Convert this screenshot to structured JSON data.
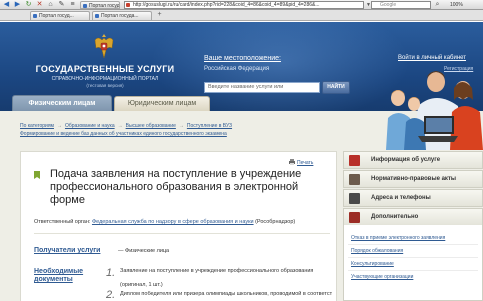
{
  "browser": {
    "tabs": [
      "Портал госуда...",
      "Портал госуд...",
      "Портал госуда..."
    ],
    "url": "http://gosuslugi.ru/ru/card/index.php?rid=228&coid_4=86&coid_4=89&pid_4=286&...",
    "search_placeholder": "Google",
    "zoom": "100%"
  },
  "header": {
    "site_title": "ГОСУДАРСТВЕННЫЕ УСЛУГИ",
    "site_subtitle": "СПРАВОЧНО-ИНФОРМАЦИОННЫЙ ПОРТАЛ",
    "site_version": "(тестовая версия)",
    "location_label": "Ваше местоположение:",
    "location_value": "Российская Федерация",
    "search_placeholder": "Введите название услуги или",
    "find_button": "НАЙТИ",
    "cabinet_link": "Войти в личный кабинет",
    "register_link": "Регистрация"
  },
  "audience_tabs": {
    "individuals": "Физическим лицам",
    "legal": "Юридическим лицам"
  },
  "breadcrumb": {
    "row1": [
      "По категориям",
      "Образование и наука",
      "Высшее образование",
      "Поступление в ВУЗ"
    ],
    "row2": [
      "Формирование и ведение баз данных об участниках единого государственного экзамена"
    ]
  },
  "card": {
    "print_label": "Печать",
    "title": "Подача заявления на поступление в учреждение профессионального образования в электронной форме",
    "dept_prefix": "Ответственный орган:",
    "dept_link": "Федеральная служба по надзору в сфере образования и науки",
    "dept_suffix": "(Рособрнадзор)",
    "recipients_label": "Получатели услуги",
    "recipients_value": "— Физические лица",
    "docs_label_1": "Необходимые",
    "docs_label_2": "документы",
    "doc1_num": "1.",
    "doc1_text": "Заявление на поступление в учреждение профессионального образования",
    "doc1_sub": "(оригинал, 1 шт.)",
    "doc2_num": "2.",
    "doc2_text": "Диплом победителя или призера олимпиады школьников, проводимой в соответствии с порядком..."
  },
  "sidebar": {
    "items": [
      {
        "label": "Информация об услуге",
        "color": "#b8302a"
      },
      {
        "label": "Нормативно-правовые акты",
        "color": "#6d5c4d"
      },
      {
        "label": "Адреса и телефоны",
        "color": "#4a4a4a"
      },
      {
        "label": "Дополнительно",
        "color": "#9c2d25"
      }
    ],
    "links": [
      "Отказ в приеме электронного заявления",
      "Порядок обжалования",
      "Консультирование",
      "Участвующие организации"
    ]
  },
  "colors": {
    "header_blue": "#1b4681",
    "link_blue": "#2f5a92",
    "content_bg": "#eeeee6"
  }
}
